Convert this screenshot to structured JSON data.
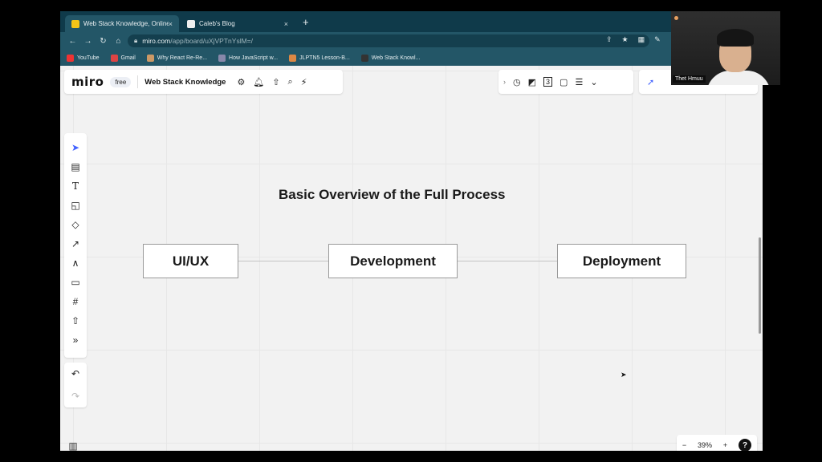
{
  "browser": {
    "tabs": [
      {
        "title": "Web Stack Knowledge, Online",
        "active": true,
        "close": "×"
      },
      {
        "title": "Caleb's Blog",
        "active": false,
        "close": "×"
      }
    ],
    "new_tab": "+",
    "nav": {
      "back": "←",
      "forward": "→",
      "reload": "↻",
      "home": "⌂"
    },
    "url_host": "miro.com",
    "url_path": "/app/board/uXjVPTnYslM=/",
    "bookmarks": [
      {
        "label": "YouTube",
        "color": "#e33"
      },
      {
        "label": "Gmail",
        "color": "#d44"
      },
      {
        "label": "Why React Re-Re...",
        "color": "#c96"
      },
      {
        "label": "How JavaScript w...",
        "color": "#88a"
      },
      {
        "label": "JLPTN5 Lesson-B...",
        "color": "#d84"
      },
      {
        "label": "Web Stack Knowl...",
        "color": "#333"
      }
    ]
  },
  "miro": {
    "logo": "miro",
    "plan": "free",
    "board_name": "Web Stack Knowledge",
    "top_icons": [
      "settings-icon",
      "bell-icon",
      "upload-icon",
      "search-icon",
      "plug-icon"
    ],
    "right_icons": [
      "chevron-right-icon",
      "timer-icon",
      "present-icon",
      "counter-icon",
      "comment-icon",
      "notes-icon",
      "more-icon"
    ],
    "tools": [
      {
        "name": "select-tool",
        "glyph": "➤"
      },
      {
        "name": "templates-tool",
        "glyph": "▤"
      },
      {
        "name": "text-tool",
        "glyph": "T"
      },
      {
        "name": "sticky-note-tool",
        "glyph": "◱"
      },
      {
        "name": "shapes-tool",
        "glyph": "◇"
      },
      {
        "name": "connection-line-tool",
        "glyph": "↗"
      },
      {
        "name": "pen-tool",
        "glyph": "∧"
      },
      {
        "name": "comment-tool",
        "glyph": "▭"
      },
      {
        "name": "frame-tool",
        "glyph": "#"
      },
      {
        "name": "upload-tool",
        "glyph": "⇧"
      },
      {
        "name": "more-tools",
        "glyph": "»"
      }
    ],
    "undo": "↶",
    "redo": "↷",
    "zoom": {
      "minus": "−",
      "level": "39%",
      "plus": "+",
      "help": "?"
    }
  },
  "board": {
    "heading": "Basic Overview of the Full Process",
    "steps": [
      "UI/UX",
      "Development",
      "Deployment"
    ]
  },
  "webcam": {
    "label": "Thet Hmuu"
  }
}
